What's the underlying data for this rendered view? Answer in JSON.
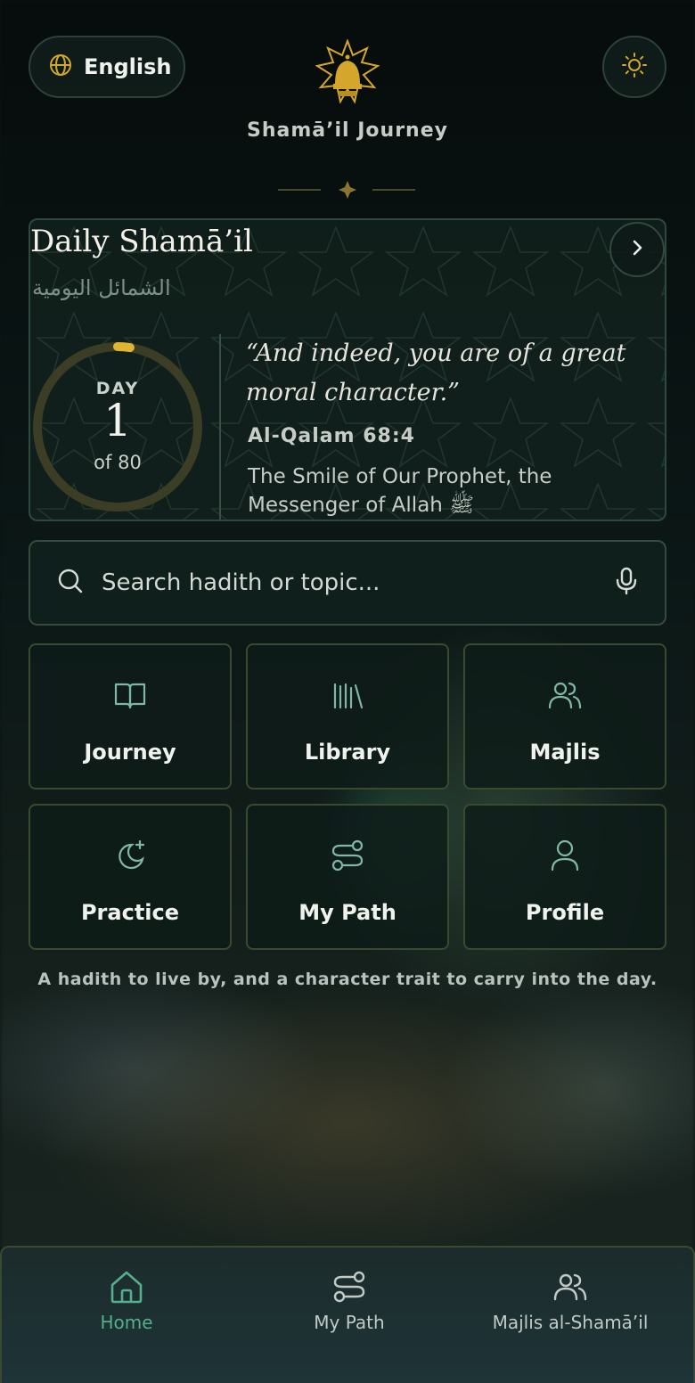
{
  "header": {
    "language_label": "English",
    "language_icon": "globe-icon",
    "theme_icon": "sun-icon",
    "app_title": "Shamā’il Journey"
  },
  "daily": {
    "title": "Daily Shamā’il",
    "arabic_title": "الشمائل اليومية",
    "day_label": "DAY",
    "day_number": "1",
    "day_total": "of 80",
    "progress": 0.0125,
    "quote": "“And indeed, you are of a great moral character.”",
    "reference": "Al-Qalam 68:4",
    "topic": "The Smile of Our Prophet, the Messenger of Allah ﷺ"
  },
  "search": {
    "placeholder": "Search hadith or topic...",
    "value": ""
  },
  "tiles": [
    {
      "label": "Journey",
      "icon": "open-book-icon"
    },
    {
      "label": "Library",
      "icon": "bookshelf-icon"
    },
    {
      "label": "Majlis",
      "icon": "users-icon"
    },
    {
      "label": "Practice",
      "icon": "moon-star-icon"
    },
    {
      "label": "My Path",
      "icon": "route-icon"
    },
    {
      "label": "Profile",
      "icon": "user-icon"
    }
  ],
  "tagline": "A hadith to live by, and a character trait to carry into the day.",
  "nav": [
    {
      "label": "Home",
      "icon": "home-icon",
      "active": true
    },
    {
      "label": "My Path",
      "icon": "route-icon",
      "active": false
    },
    {
      "label": "Majlis al-Shamā’il",
      "icon": "users-icon",
      "active": false
    }
  ],
  "colors": {
    "accent_gold": "#d4a72c",
    "active_green": "#54b08b",
    "icon_teal": "#7fb9a6"
  }
}
